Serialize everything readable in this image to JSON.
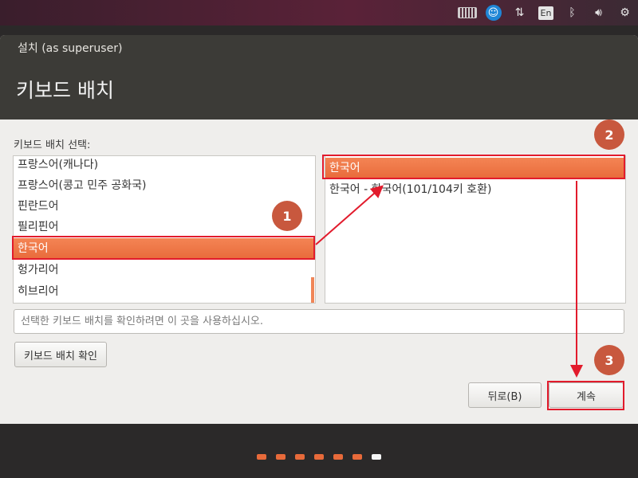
{
  "window": {
    "title": "설치 (as superuser)"
  },
  "page": {
    "title": "키보드 배치"
  },
  "layout_section": {
    "label": "키보드 배치 선택:"
  },
  "layout_list": {
    "items": [
      "프랑스어(캐나다)",
      "프랑스어(콩고 민주 공화국)",
      "핀란드어",
      "필리핀어",
      "한국어",
      "헝가리어",
      "히브리어"
    ],
    "selected": "한국어"
  },
  "variant_list": {
    "items": [
      "한국어",
      "한국어 - 한국어(101/104키 호환)"
    ],
    "selected": "한국어"
  },
  "test_input": {
    "placeholder": "선택한 키보드 배치를 확인하려면 이 곳을 사용하십시오."
  },
  "buttons": {
    "detect": "키보드 배치 확인",
    "back": "뒤로(B)",
    "continue": "계속"
  },
  "tray": {
    "language": "En"
  },
  "annotations": {
    "badge1": "1",
    "badge2": "2",
    "badge3": "3"
  },
  "progress": {
    "total": 7,
    "current": 7
  },
  "colors": {
    "accent": "#e86a3a",
    "annotation": "#e21b2c",
    "badge": "#c8583e"
  }
}
